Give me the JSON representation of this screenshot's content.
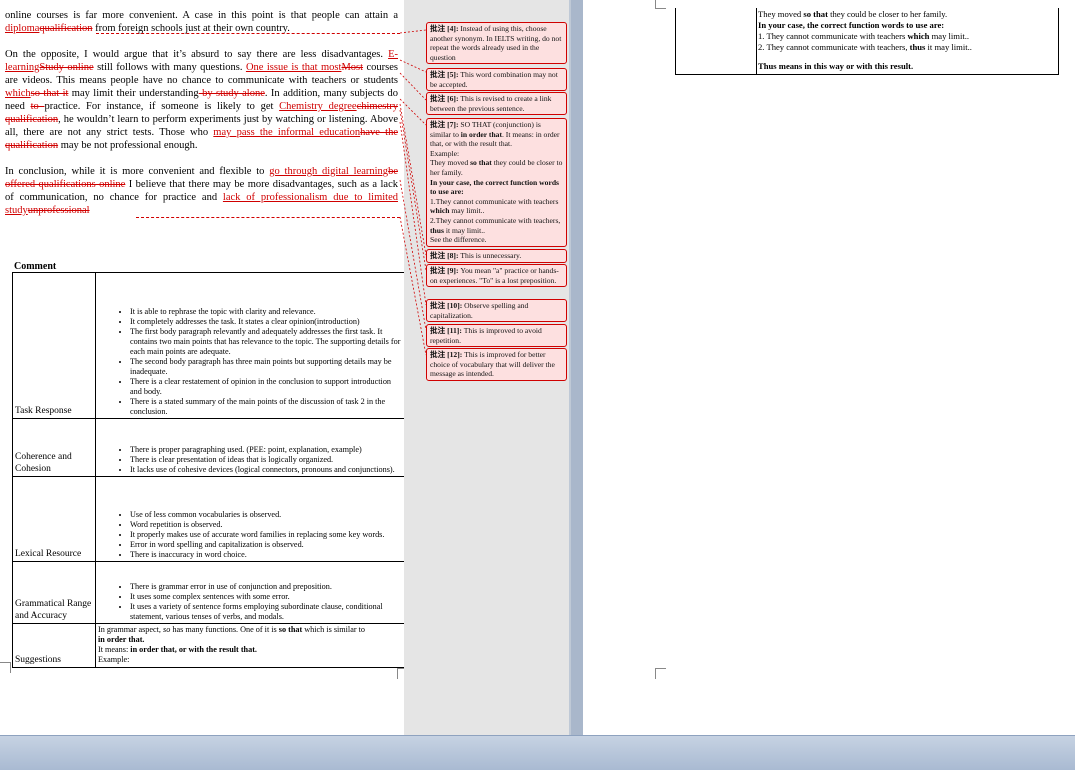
{
  "left_page": {
    "p1": [
      {
        "t": "online courses is far more convenient. A case in this point is that people can attain a "
      },
      {
        "t": "diploma",
        "ins": true
      },
      {
        "t": "qualification",
        "del": true
      },
      {
        "t": " from foreign schools just at their own country."
      }
    ],
    "p2": [
      {
        "t": "On the opposite, I would argue that it’s absurd to say there are less disadvantages. "
      },
      {
        "t": "E-learning",
        "ins": true
      },
      {
        "t": "Study online",
        "del": true
      },
      {
        "t": " still follows with many questions. "
      },
      {
        "t": "One issue is that most",
        "ins": true
      },
      {
        "t": "Most",
        "del": true
      },
      {
        "t": " courses are videos. This means people have no chance to communicate with teachers or students "
      },
      {
        "t": "which",
        "ins": true
      },
      {
        "t": "so that it",
        "del": true
      },
      {
        "t": " may limit their understanding"
      },
      {
        "t": " by study alone",
        "del": true
      },
      {
        "t": ". In addition, many subjects do need "
      },
      {
        "t": "to ",
        "del": true
      },
      {
        "t": "practice. For instance, if someone is likely to get "
      },
      {
        "t": "Chemistry degree",
        "ins": true
      },
      {
        "t": "chimestry qualification",
        "del": true
      },
      {
        "t": ", he wouldn’t learn to perform experiments just by watching or listening. Above all, there are not any strict tests. Those who "
      },
      {
        "t": "may pass the informal education",
        "ins": true
      },
      {
        "t": "have the qualification",
        "del": true
      },
      {
        "t": " may be not professional enough."
      }
    ],
    "p3": [
      {
        "t": "In conclusion, while it is more convenient and flexible to "
      },
      {
        "t": "go through digital learning",
        "ins": true
      },
      {
        "t": "be offered qualifications online",
        "del": true
      },
      {
        "t": " I believe that there may be more disadvantages, such as a lack of communication, no chance for practice and "
      },
      {
        "t": "lack of professionalism due to limited study",
        "ins": true
      },
      {
        "t": "unprofessional",
        "del": true
      }
    ],
    "table_caption": "Comment",
    "rubric": [
      {
        "criterion": "Task Response",
        "points": [
          "It is able to rephrase the topic with clarity and relevance.",
          "It completely addresses the task. It states a clear opinion(introduction)",
          "The first body paragraph relevantly and adequately addresses the first task. It contains two main points that has relevance to the topic. The supporting details for each main points are adequate.",
          "The second body paragraph has three main points but supporting details may be inadequate.",
          "There is a clear restatement of opinion in the conclusion to support introduction and body.",
          "There is a stated summary of the main points of the discussion of task 2 in the conclusion."
        ]
      },
      {
        "criterion": "Coherence and Cohesion",
        "points": [
          "There is proper paragraphing used. (PEE: point, explanation, example)",
          "There is clear presentation of ideas that is logically organized.",
          "It lacks use of cohesive devices  (logical connectors, pronouns and conjunctions)."
        ]
      },
      {
        "criterion": "Lexical Resource",
        "points": [
          "Use of less common vocabularies is observed.",
          "Word repetition is observed.",
          "It properly makes use of accurate word families in replacing some key words.",
          "Error in word spelling and capitalization is observed.",
          "There is inaccuracy in word choice."
        ]
      },
      {
        "criterion": "Grammatical Range and Accuracy",
        "points": [
          "There is grammar  error in use of conjunction and preposition.",
          "It uses some complex sentences with some error.",
          "It uses a variety of sentence forms employing subordinate clause, conditional statement, various tenses of verbs, and modals."
        ]
      }
    ],
    "suggestions": {
      "criterion": "Suggestions",
      "line1_a": " In grammar aspect, ",
      "line1_so": "so",
      "line1_b": " has many functions. One of it is ",
      "line1_c": "so that",
      "line1_d": " which is similar to",
      "line2": "in order that.",
      "line3_a": "It means: ",
      "line3_b": "in order that, or with  the result that.",
      "line4": "Example:"
    }
  },
  "comments": [
    {
      "tag": "批注 [4]:",
      "text": " Instead of using this, choose another synonym. In IELTS writing, do not repeat the words already used in the question"
    },
    {
      "tag": "批注 [5]:",
      "text": " This word combination may not be accepted."
    },
    {
      "tag": "批注 [6]:",
      "text": " This is revised to create a link between the previous sentence."
    },
    {
      "tag": "批注 [7]:",
      "text": " SO THAT (conjunction) is similar to ",
      "b1": "in order that",
      "text2": ". It means: in order that, or with the result that.",
      "ex_label": "Example:",
      "ex1": "They moved ",
      "ex1b": "so that",
      "ex1c": " they could be closer to her family.",
      "bold_line": "In your case, the correct function words to use are:",
      "l1": "1.They cannot communicate with teachers ",
      "l1b": "which",
      "l1c": " may limit..",
      "l2": "2.They cannot communicate with teachers, ",
      "l2b": "thus",
      "l2c": " it may limit..",
      "see": "See the difference."
    },
    {
      "tag": "批注 [8]:",
      "text": " This is unnecessary."
    },
    {
      "tag": "批注 [9]:",
      "text": " You mean \"a\" practice or hands-on experiences. \"To\" is a lost preposition."
    },
    {
      "tag": "批注 [10]:",
      "text": " Observe spelling and capitalization."
    },
    {
      "tag": "批注 [11]:",
      "text": " This is improved to avoid repetition."
    },
    {
      "tag": "批注 [12]:",
      "text": " This is improved for better choice of vocabulary that will deliver the message as intended."
    }
  ],
  "right_page": {
    "l1a": "They moved ",
    "l1b": "so that",
    "l1c": " they could be closer to her family.",
    "l2": "In your case, the correct function words to use are:",
    "l3a": "1. They cannot communicate with teachers ",
    "l3b": "which",
    "l3c": " may limit..",
    "l4a": "2. They cannot communicate with teachers, ",
    "l4b": "thus",
    "l4c": " it may limit..",
    "l5": "Thus means in this way or with  this result."
  },
  "colors": {
    "revision": "#d00000",
    "comment_bg": "#fde0e0",
    "workspace": "#a9b7cb"
  }
}
